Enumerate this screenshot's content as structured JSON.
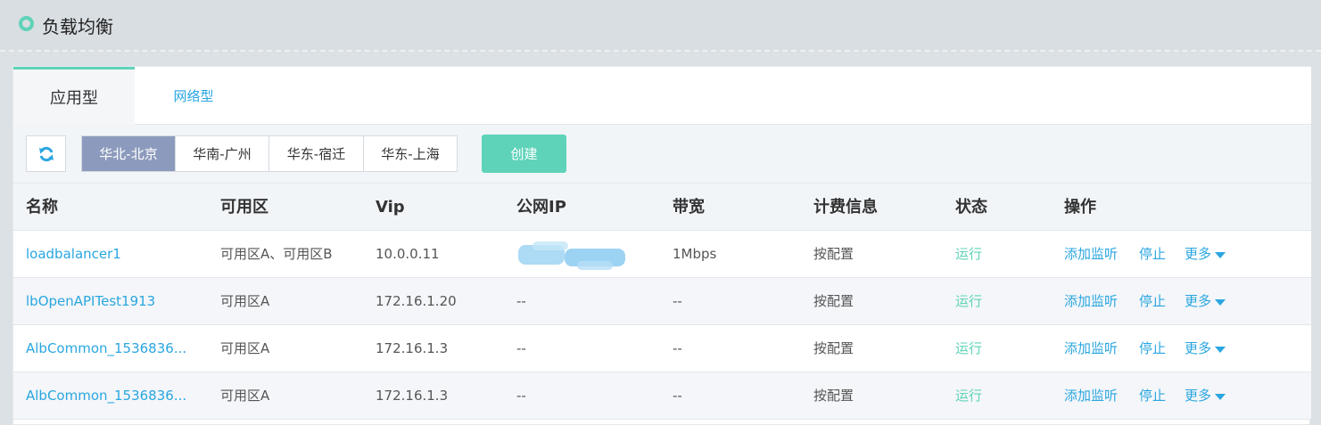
{
  "header": {
    "title": "负载均衡"
  },
  "tabs": [
    {
      "label": "应用型",
      "active": true
    },
    {
      "label": "网络型",
      "active": false
    }
  ],
  "toolbar": {
    "regions": [
      {
        "label": "华北-北京",
        "active": true
      },
      {
        "label": "华南-广州",
        "active": false
      },
      {
        "label": "华东-宿迁",
        "active": false
      },
      {
        "label": "华东-上海",
        "active": false
      }
    ],
    "create_label": "创建"
  },
  "table": {
    "columns": [
      "名称",
      "可用区",
      "Vip",
      "公网IP",
      "带宽",
      "计费信息",
      "状态",
      "操作"
    ],
    "rows": [
      {
        "name": "loadbalancer1",
        "zone": "可用区A、可用区B",
        "vip": "10.0.0.11",
        "public_ip": "",
        "bandwidth": "1Mbps",
        "billing": "按配置",
        "status": "运行"
      },
      {
        "name": "lbOpenAPITest1913",
        "zone": "可用区A",
        "vip": "172.16.1.20",
        "public_ip": "--",
        "bandwidth": "--",
        "billing": "按配置",
        "status": "运行"
      },
      {
        "name": "AlbCommon_1536836...",
        "zone": "可用区A",
        "vip": "172.16.1.3",
        "public_ip": "--",
        "bandwidth": "--",
        "billing": "按配置",
        "status": "运行"
      },
      {
        "name": "AlbCommon_1536836...",
        "zone": "可用区A",
        "vip": "172.16.1.3",
        "public_ip": "--",
        "bandwidth": "--",
        "billing": "按配置",
        "status": "运行"
      }
    ],
    "actions": {
      "add_listener": "添加监听",
      "stop": "停止",
      "more": "更多"
    }
  },
  "colors": {
    "accent": "#5fd3b9",
    "link": "#2aa6e0",
    "region_active": "#8c9bbd"
  },
  "icons": {
    "refresh": "refresh-icon",
    "header": "ring-icon"
  }
}
